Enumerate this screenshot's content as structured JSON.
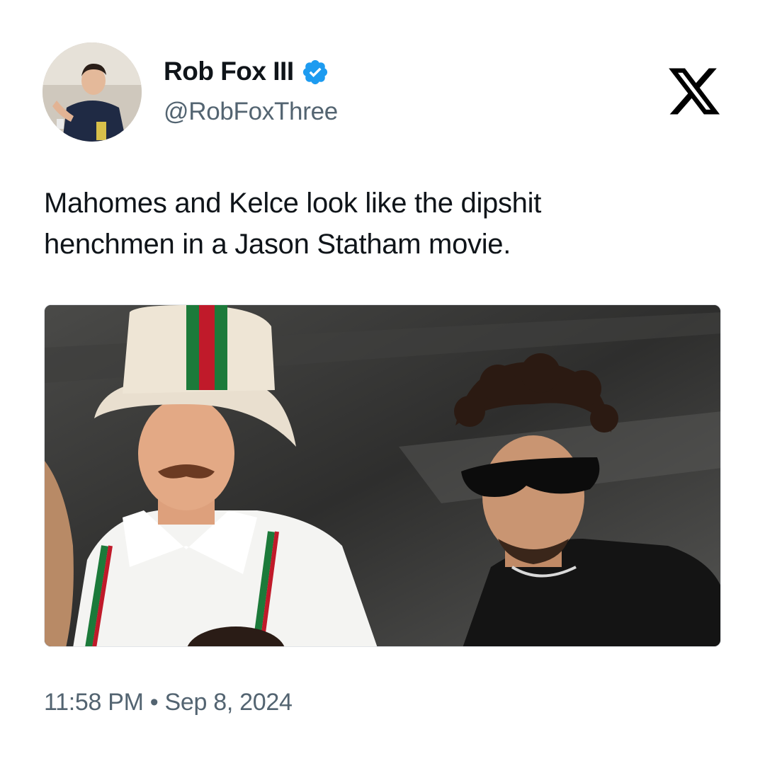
{
  "tweet": {
    "author": {
      "display_name": "Rob Fox III",
      "handle": "@RobFoxThree",
      "verified": true,
      "verified_badge_color": "#1d9bf0"
    },
    "text": "Mahomes and Kelce look like the dipshit\nhenchmen in a Jason Statham movie.",
    "time": "11:58 PM",
    "separator": "•",
    "date": "Sep 8, 2024"
  },
  "platform": {
    "logo_icon": "x-logo-icon"
  },
  "colors": {
    "text_primary": "#0f1419",
    "text_secondary": "#536471"
  }
}
